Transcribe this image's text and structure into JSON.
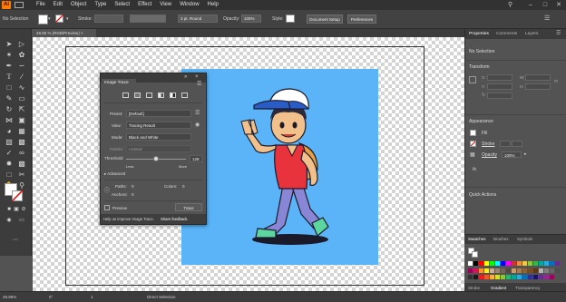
{
  "menu": [
    "File",
    "Edit",
    "Object",
    "Type",
    "Select",
    "Effect",
    "View",
    "Window",
    "Help"
  ],
  "app_logo": "Ai",
  "control_bar": {
    "selection": "No Selection",
    "stroke_label": "Stroke:",
    "stroke_profile": "3 pt. Round",
    "opacity_label": "Opacity:",
    "opacity_value": "100%",
    "style_label": "Style:",
    "document_setup": "Document Setup",
    "preferences": "Preferences"
  },
  "document_tab": "48.86 % (RGB/Preview)",
  "image_trace": {
    "title": "Image Trace",
    "preset_label": "Preset:",
    "preset_value": "[Default]",
    "view_label": "View:",
    "view_value": "Tracing Result",
    "mode_label": "Mode:",
    "mode_value": "Black and White",
    "palette_label": "Palette:",
    "palette_value": "Limited",
    "threshold_label": "Threshold:",
    "threshold_value": "128",
    "threshold_fraction": 0.5,
    "less_label": "Less",
    "more_label": "More",
    "advanced_label": "Advanced",
    "paths_label": "Paths:",
    "paths_value": "0",
    "colors_label": "Colors:",
    "colors_value": "0",
    "anchors_label": "Anchors:",
    "anchors_value": "0",
    "preview_label": "Preview",
    "trace_button": "Trace",
    "help_text": "Help us improve Image Trace.",
    "share_feedback": "Share feedback."
  },
  "right_panel": {
    "tabs": [
      "Properties",
      "Comments",
      "Layers"
    ],
    "no_selection": "No Selection",
    "transform": "Transform",
    "x_label": "X:",
    "y_label": "Y:",
    "w_label": "W:",
    "h_label": "H:",
    "appearance": "Appearance",
    "fill_label": "Fill",
    "stroke_label": "Stroke",
    "opacity_label": "Opacity",
    "opacity_value": "100%",
    "fx_label": "fx.",
    "quick_actions": "Quick Actions",
    "swatches_tabs": [
      "Swatches",
      "Brushes",
      "Symbols"
    ],
    "bottom_tabs": [
      "Stroke",
      "Gradient",
      "Transparency"
    ],
    "swatch_colors": [
      "#ffffff",
      "#000000",
      "#ff0000",
      "#ffff00",
      "#00ff00",
      "#00ffff",
      "#0000ff",
      "#ff00ff",
      "#cc3333",
      "#e98e3c",
      "#f2c93a",
      "#8dc63f",
      "#39b54a",
      "#00a99d",
      "#29abe2",
      "#0071bc",
      "#662d91",
      "#9e005d",
      "#d4145a",
      "#f7931e",
      "#fcee21",
      "#c7b299",
      "#998675",
      "#736357",
      "#534741",
      "#c69c6d",
      "#a67c52",
      "#8c6239",
      "#754c24",
      "#603813",
      "#b3b3b3",
      "#808080",
      "#666666",
      "#4d4d4d",
      "#333333",
      "#1a1a1a",
      "#ed1c24",
      "#f15a24",
      "#fbb03b",
      "#d9e021",
      "#8cc63f",
      "#22b573",
      "#00a99d",
      "#29abe2",
      "#0071bc",
      "#2e3192",
      "#1b1464",
      "#662d91",
      "#93278f",
      "#9e005d"
    ]
  },
  "status_bar": {
    "zoom": "48.86%",
    "angle": "0°",
    "page": "1",
    "tool": "Direct Selection"
  },
  "colors": {
    "artboard_bg": "#5ab4f7",
    "accent": "#ff7c00"
  }
}
